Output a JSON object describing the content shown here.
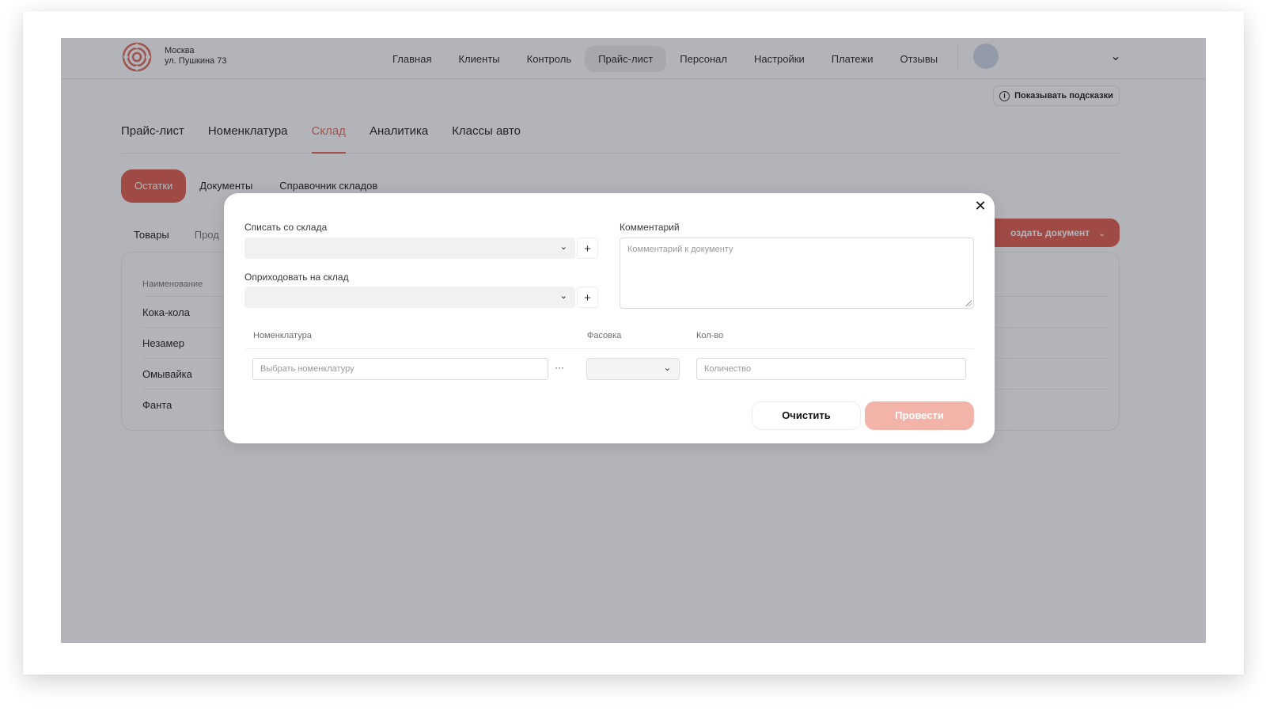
{
  "header": {
    "location_city": "Москва",
    "location_address": "ул. Пушкина 73",
    "nav": [
      "Главная",
      "Клиенты",
      "Контроль",
      "Прайс-лист",
      "Персонал",
      "Настройки",
      "Платежи",
      "Отзывы"
    ],
    "active_nav_index": 3,
    "hints_button": "Показывать подсказки"
  },
  "section_tabs": {
    "items": [
      "Прайс-лист",
      "Номенклатура",
      "Склад",
      "Аналитика",
      "Классы авто"
    ],
    "active_index": 2
  },
  "sub_tabs": {
    "items": [
      "Остатки",
      "Документы",
      "Справочник складов"
    ],
    "active_index": 0
  },
  "card": {
    "tabs": [
      "Товары",
      "Прод"
    ],
    "create_button": "оздать документ",
    "column_name": "Наименование",
    "rows": [
      "Кока-кола",
      "Незамер",
      "Омывайка",
      "Фанта"
    ]
  },
  "modal": {
    "write_off_label": "Списать со склада",
    "receive_label": "Оприходовать на склад",
    "comment_label": "Комментарий",
    "comment_placeholder": "Комментарий к документу",
    "col_nomenclature": "Номенклатура",
    "col_packing": "Фасовка",
    "col_qty": "Кол-во",
    "nomenclature_placeholder": "Выбрать номенклатуру",
    "qty_placeholder": "Количество",
    "clear_button": "Очистить",
    "post_button": "Провести"
  },
  "colors": {
    "accent": "#e35f50",
    "accent_disabled": "#f2b3a8",
    "overlay": "rgba(32,36,50,0.34)"
  }
}
